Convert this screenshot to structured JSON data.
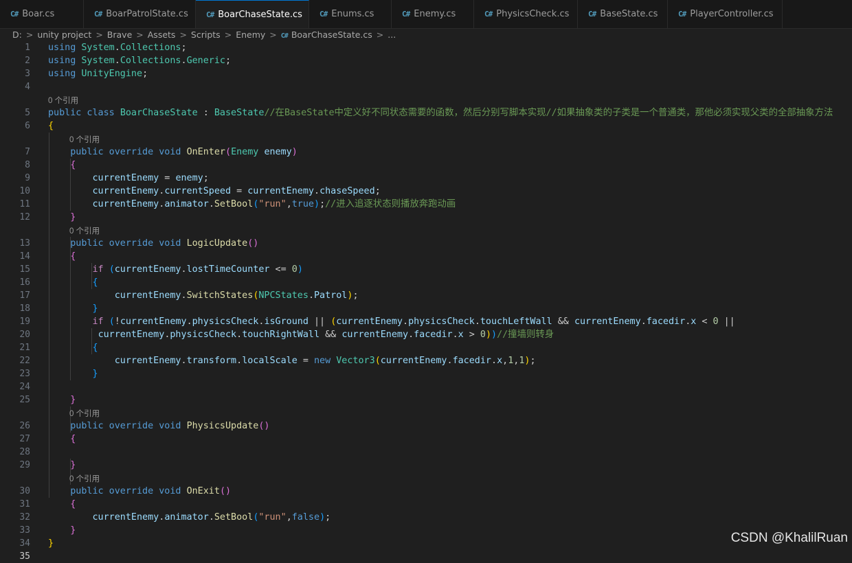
{
  "tabs": [
    {
      "label": "Boar.cs",
      "active": false,
      "dirty": false
    },
    {
      "label": "BoarPatrolState.cs",
      "active": false,
      "dirty": false
    },
    {
      "label": "BoarChaseState.cs",
      "active": true,
      "dirty": true
    },
    {
      "label": "Enums.cs",
      "active": false,
      "dirty": false
    },
    {
      "label": "Enemy.cs",
      "active": false,
      "dirty": false
    },
    {
      "label": "PhysicsCheck.cs",
      "active": false,
      "dirty": false
    },
    {
      "label": "BaseState.cs",
      "active": false,
      "dirty": false
    },
    {
      "label": "PlayerController.cs",
      "active": false,
      "dirty": false
    }
  ],
  "tab_icon": "C#",
  "breadcrumb": [
    "D:",
    "unity project",
    "Brave",
    "Assets",
    "Scripts",
    "Enemy",
    "BoarChaseState.cs",
    "..."
  ],
  "codelens_text": "0 个引用",
  "current_line": 35,
  "lines": [
    {
      "n": 1,
      "t": [
        [
          "kw",
          "using "
        ],
        [
          "ty",
          "System"
        ],
        [
          "pl",
          "."
        ],
        [
          "ty",
          "Collections"
        ],
        [
          "pl",
          ";"
        ]
      ]
    },
    {
      "n": 2,
      "t": [
        [
          "kw",
          "using "
        ],
        [
          "ty",
          "System"
        ],
        [
          "pl",
          "."
        ],
        [
          "ty",
          "Collections"
        ],
        [
          "pl",
          "."
        ],
        [
          "ty",
          "Generic"
        ],
        [
          "pl",
          ";"
        ]
      ]
    },
    {
      "n": 3,
      "t": [
        [
          "kw",
          "using "
        ],
        [
          "ty",
          "UnityEngine"
        ],
        [
          "pl",
          ";"
        ]
      ]
    },
    {
      "n": 4,
      "t": []
    },
    {
      "lens": true,
      "indent": 0
    },
    {
      "n": 5,
      "t": [
        [
          "kw",
          "public class "
        ],
        [
          "ty",
          "BoarChaseState"
        ],
        [
          "pl",
          " : "
        ],
        [
          "ty",
          "BaseState"
        ],
        [
          "cm",
          "//在BaseState中定义好不同状态需要的函数，然后分别写脚本实现//如果抽象类的子类是一个普通类，那他必须实现父类的全部抽象方法"
        ]
      ]
    },
    {
      "n": 6,
      "t": [
        [
          "b1",
          "{"
        ]
      ]
    },
    {
      "lens": true,
      "indent": 1
    },
    {
      "n": 7,
      "t": [
        [
          "pl",
          "    "
        ],
        [
          "kw",
          "public override void "
        ],
        [
          "fn",
          "OnEnter"
        ],
        [
          "b2",
          "("
        ],
        [
          "ty",
          "Enemy "
        ],
        [
          "vr",
          "enemy"
        ],
        [
          "b2",
          ")"
        ]
      ]
    },
    {
      "n": 8,
      "t": [
        [
          "pl",
          "    "
        ],
        [
          "b2",
          "{"
        ]
      ]
    },
    {
      "n": 9,
      "t": [
        [
          "pl",
          "        "
        ],
        [
          "vr",
          "currentEnemy"
        ],
        [
          "pl",
          " = "
        ],
        [
          "vr",
          "enemy"
        ],
        [
          "pl",
          ";"
        ]
      ]
    },
    {
      "n": 10,
      "t": [
        [
          "pl",
          "        "
        ],
        [
          "vr",
          "currentEnemy"
        ],
        [
          "pl",
          "."
        ],
        [
          "vr",
          "currentSpeed"
        ],
        [
          "pl",
          " = "
        ],
        [
          "vr",
          "currentEnemy"
        ],
        [
          "pl",
          "."
        ],
        [
          "vr",
          "chaseSpeed"
        ],
        [
          "pl",
          ";"
        ]
      ]
    },
    {
      "n": 11,
      "t": [
        [
          "pl",
          "        "
        ],
        [
          "vr",
          "currentEnemy"
        ],
        [
          "pl",
          "."
        ],
        [
          "vr",
          "animator"
        ],
        [
          "pl",
          "."
        ],
        [
          "fn",
          "SetBool"
        ],
        [
          "b3",
          "("
        ],
        [
          "st",
          "\"run\""
        ],
        [
          "pl",
          ","
        ],
        [
          "kw",
          "true"
        ],
        [
          "b3",
          ")"
        ],
        [
          "pl",
          ";"
        ],
        [
          "cm",
          "//进入追逐状态则播放奔跑动画"
        ]
      ]
    },
    {
      "n": 12,
      "t": [
        [
          "pl",
          "    "
        ],
        [
          "b2",
          "}"
        ]
      ]
    },
    {
      "lens": true,
      "indent": 1
    },
    {
      "n": 13,
      "t": [
        [
          "pl",
          "    "
        ],
        [
          "kw",
          "public override void "
        ],
        [
          "fn",
          "LogicUpdate"
        ],
        [
          "b2",
          "()"
        ]
      ]
    },
    {
      "n": 14,
      "t": [
        [
          "pl",
          "    "
        ],
        [
          "b2",
          "{"
        ]
      ]
    },
    {
      "n": 15,
      "t": [
        [
          "pl",
          "        "
        ],
        [
          "ctl",
          "if "
        ],
        [
          "b3",
          "("
        ],
        [
          "vr",
          "currentEnemy"
        ],
        [
          "pl",
          "."
        ],
        [
          "vr",
          "lostTimeCounter"
        ],
        [
          "pl",
          " <= "
        ],
        [
          "nm",
          "0"
        ],
        [
          "b3",
          ")"
        ]
      ]
    },
    {
      "n": 16,
      "t": [
        [
          "pl",
          "        "
        ],
        [
          "b3",
          "{"
        ]
      ]
    },
    {
      "n": 17,
      "t": [
        [
          "pl",
          "            "
        ],
        [
          "vr",
          "currentEnemy"
        ],
        [
          "pl",
          "."
        ],
        [
          "fn",
          "SwitchStates"
        ],
        [
          "b1",
          "("
        ],
        [
          "ty",
          "NPCStates"
        ],
        [
          "pl",
          "."
        ],
        [
          "vr",
          "Patrol"
        ],
        [
          "b1",
          ")"
        ],
        [
          "pl",
          ";"
        ]
      ]
    },
    {
      "n": 18,
      "t": [
        [
          "pl",
          "        "
        ],
        [
          "b3",
          "}"
        ]
      ]
    },
    {
      "n": 19,
      "t": [
        [
          "pl",
          "        "
        ],
        [
          "ctl",
          "if "
        ],
        [
          "b3",
          "("
        ],
        [
          "pl",
          "!"
        ],
        [
          "vr",
          "currentEnemy"
        ],
        [
          "pl",
          "."
        ],
        [
          "vr",
          "physicsCheck"
        ],
        [
          "pl",
          "."
        ],
        [
          "vr",
          "isGround"
        ],
        [
          "pl",
          " || "
        ],
        [
          "b1",
          "("
        ],
        [
          "vr",
          "currentEnemy"
        ],
        [
          "pl",
          "."
        ],
        [
          "vr",
          "physicsCheck"
        ],
        [
          "pl",
          "."
        ],
        [
          "vr",
          "touchLeftWall"
        ],
        [
          "pl",
          " && "
        ],
        [
          "vr",
          "currentEnemy"
        ],
        [
          "pl",
          "."
        ],
        [
          "vr",
          "facedir"
        ],
        [
          "pl",
          "."
        ],
        [
          "vr",
          "x"
        ],
        [
          "pl",
          " < "
        ],
        [
          "nm",
          "0"
        ],
        [
          "pl",
          " ||"
        ]
      ]
    },
    {
      "n": 20,
      "t": [
        [
          "pl",
          "         "
        ],
        [
          "vr",
          "currentEnemy"
        ],
        [
          "pl",
          "."
        ],
        [
          "vr",
          "physicsCheck"
        ],
        [
          "pl",
          "."
        ],
        [
          "vr",
          "touchRightWall"
        ],
        [
          "pl",
          " && "
        ],
        [
          "vr",
          "currentEnemy"
        ],
        [
          "pl",
          "."
        ],
        [
          "vr",
          "facedir"
        ],
        [
          "pl",
          "."
        ],
        [
          "vr",
          "x"
        ],
        [
          "pl",
          " > "
        ],
        [
          "nm",
          "0"
        ],
        [
          "b1",
          ")"
        ],
        [
          "b3",
          ")"
        ],
        [
          "cm",
          "//撞墙则转身"
        ]
      ]
    },
    {
      "n": 21,
      "t": [
        [
          "pl",
          "        "
        ],
        [
          "b3",
          "{"
        ]
      ]
    },
    {
      "n": 22,
      "t": [
        [
          "pl",
          "            "
        ],
        [
          "vr",
          "currentEnemy"
        ],
        [
          "pl",
          "."
        ],
        [
          "vr",
          "transform"
        ],
        [
          "pl",
          "."
        ],
        [
          "vr",
          "localScale"
        ],
        [
          "pl",
          " = "
        ],
        [
          "kw",
          "new "
        ],
        [
          "ty",
          "Vector3"
        ],
        [
          "b1",
          "("
        ],
        [
          "vr",
          "currentEnemy"
        ],
        [
          "pl",
          "."
        ],
        [
          "vr",
          "facedir"
        ],
        [
          "pl",
          "."
        ],
        [
          "vr",
          "x"
        ],
        [
          "pl",
          ","
        ],
        [
          "nm",
          "1"
        ],
        [
          "pl",
          ","
        ],
        [
          "nm",
          "1"
        ],
        [
          "b1",
          ")"
        ],
        [
          "pl",
          ";"
        ]
      ]
    },
    {
      "n": 23,
      "t": [
        [
          "pl",
          "        "
        ],
        [
          "b3",
          "}"
        ]
      ]
    },
    {
      "n": 24,
      "t": []
    },
    {
      "n": 25,
      "t": [
        [
          "pl",
          "    "
        ],
        [
          "b2",
          "}"
        ]
      ]
    },
    {
      "lens": true,
      "indent": 1
    },
    {
      "n": 26,
      "t": [
        [
          "pl",
          "    "
        ],
        [
          "kw",
          "public override void "
        ],
        [
          "fn",
          "PhysicsUpdate"
        ],
        [
          "b2",
          "()"
        ]
      ]
    },
    {
      "n": 27,
      "t": [
        [
          "pl",
          "    "
        ],
        [
          "b2",
          "{"
        ]
      ]
    },
    {
      "n": 28,
      "t": []
    },
    {
      "n": 29,
      "t": [
        [
          "pl",
          "    "
        ],
        [
          "b2",
          "}"
        ]
      ]
    },
    {
      "lens": true,
      "indent": 1
    },
    {
      "n": 30,
      "t": [
        [
          "pl",
          "    "
        ],
        [
          "kw",
          "public override void "
        ],
        [
          "fn",
          "OnExit"
        ],
        [
          "b2",
          "()"
        ]
      ]
    },
    {
      "n": 31,
      "t": [
        [
          "pl",
          "    "
        ],
        [
          "b2",
          "{"
        ]
      ]
    },
    {
      "n": 32,
      "t": [
        [
          "pl",
          "        "
        ],
        [
          "vr",
          "currentEnemy"
        ],
        [
          "pl",
          "."
        ],
        [
          "vr",
          "animator"
        ],
        [
          "pl",
          "."
        ],
        [
          "fn",
          "SetBool"
        ],
        [
          "b3",
          "("
        ],
        [
          "st",
          "\"run\""
        ],
        [
          "pl",
          ","
        ],
        [
          "kw",
          "false"
        ],
        [
          "b3",
          ")"
        ],
        [
          "pl",
          ";"
        ]
      ]
    },
    {
      "n": 33,
      "t": [
        [
          "pl",
          "    "
        ],
        [
          "b2",
          "}"
        ]
      ]
    },
    {
      "n": 34,
      "t": [
        [
          "b1",
          "}"
        ]
      ]
    },
    {
      "n": 35,
      "t": []
    }
  ],
  "watermark": "CSDN @KhalilRuan"
}
